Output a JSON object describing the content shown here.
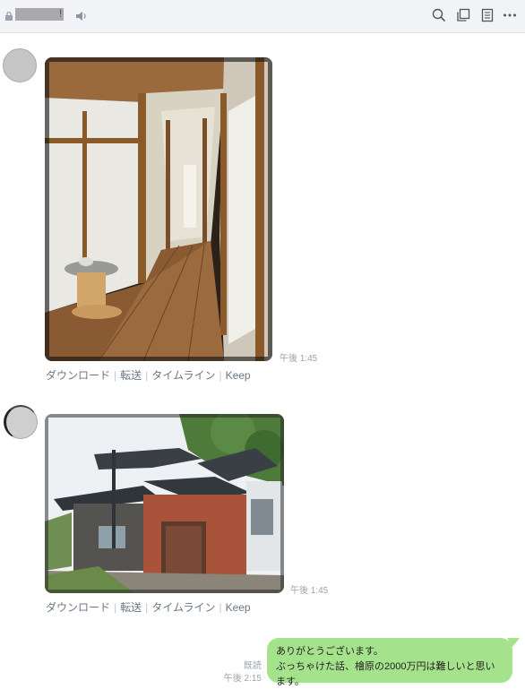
{
  "header": {
    "title_suffix": "!",
    "icons": [
      "lock-icon",
      "speaker-icon",
      "search-icon",
      "copy-icon",
      "note-icon",
      "more-icon"
    ]
  },
  "messages": [
    {
      "type": "photo",
      "subject": "corridor",
      "time": "午後 1:45",
      "actions": [
        "ダウンロード",
        "転送",
        "タイムライン",
        "Keep"
      ]
    },
    {
      "type": "photo",
      "subject": "house",
      "time": "午後 1:45",
      "actions": [
        "ダウンロード",
        "転送",
        "タイムライン",
        "Keep"
      ]
    },
    {
      "type": "text",
      "read": "既読",
      "time": "午後 2:15",
      "lines": [
        "ありがとうございます。",
        "ぶっちゃけた話、檜原の2000万円は難しいと思います。"
      ]
    }
  ],
  "colors": {
    "header_bg": "#f1f3f6",
    "bubble_green": "#a5e28c",
    "meta_gray": "#9aa3ad",
    "action_gray": "#6b7785"
  }
}
